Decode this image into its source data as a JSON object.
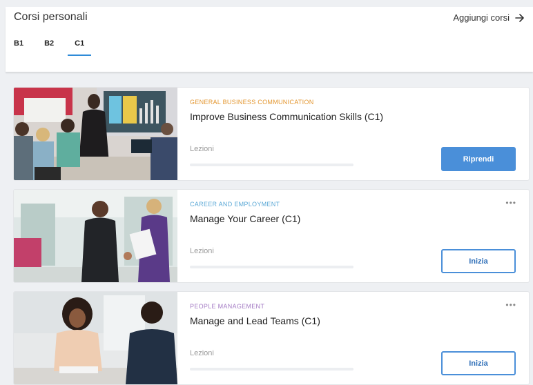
{
  "header": {
    "title": "Corsi personali",
    "add_courses_label": "Aggiungi corsi",
    "add_courses_icon": "arrow-right-icon"
  },
  "tabs": [
    {
      "label": "B1",
      "active": false
    },
    {
      "label": "B2",
      "active": false
    },
    {
      "label": "C1",
      "active": true
    }
  ],
  "courses": [
    {
      "category": "GENERAL BUSINESS COMMUNICATION",
      "category_color": "#e3962f",
      "title": "Improve Business Communication Skills (C1)",
      "lessons_label": "Lezioni",
      "progress": 0,
      "button_label": "Riprendi",
      "button_style": "primary",
      "has_more_menu": false
    },
    {
      "category": "CAREER AND EMPLOYMENT",
      "category_color": "#5aa8d6",
      "title": "Manage Your Career (C1)",
      "lessons_label": "Lezioni",
      "progress": 0,
      "button_label": "Inizia",
      "button_style": "secondary",
      "has_more_menu": true,
      "more_label": "•••"
    },
    {
      "category": "PEOPLE MANAGEMENT",
      "category_color": "#a47bc4",
      "title": "Manage and Lead Teams (C1)",
      "lessons_label": "Lezioni",
      "progress": 0,
      "button_label": "Inizia",
      "button_style": "secondary",
      "has_more_menu": true,
      "more_label": "•••"
    }
  ],
  "colors": {
    "accent": "#2f8bd8",
    "button_primary": "#4a8fd9",
    "background": "#eef0f3"
  }
}
